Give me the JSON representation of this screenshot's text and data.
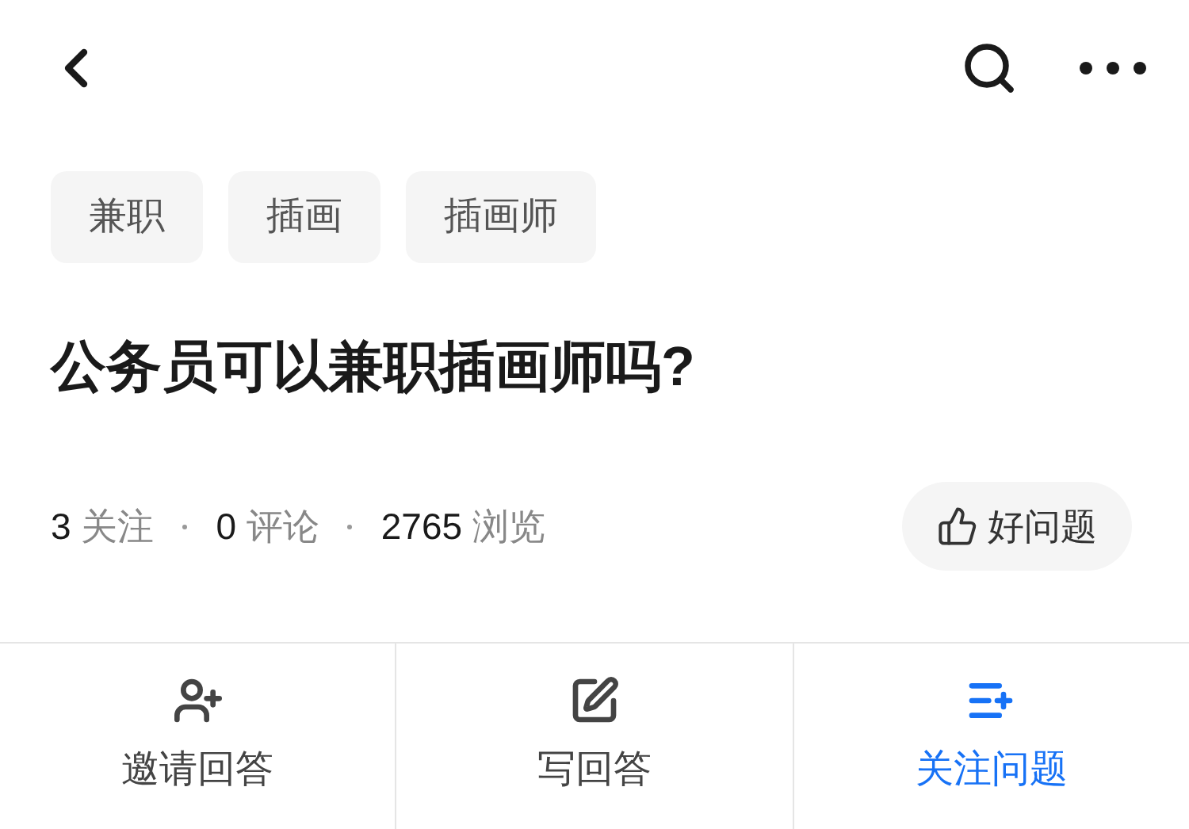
{
  "tags": [
    "兼职",
    "插画",
    "插画师"
  ],
  "title": "公务员可以兼职插画师吗?",
  "stats": [
    {
      "count": "3",
      "label": "关注"
    },
    {
      "count": "0",
      "label": "评论"
    },
    {
      "count": "2765",
      "label": "浏览"
    }
  ],
  "good_question_button": {
    "label": "好问题"
  },
  "actions": [
    {
      "kind": "invite",
      "label": "邀请回答",
      "selected": false
    },
    {
      "kind": "write",
      "label": "写回答",
      "selected": false
    },
    {
      "kind": "follow",
      "label": "关注问题",
      "selected": true
    }
  ]
}
